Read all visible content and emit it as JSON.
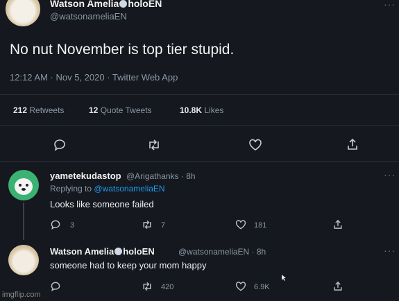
{
  "main_tweet": {
    "author_name_a": "Watson Amelia",
    "author_name_b": "holoEN",
    "handle": "@watsonameliaEN",
    "text": "No nut November is top tier stupid.",
    "timestamp": "12:12 AM · Nov 5, 2020 · Twitter Web App",
    "stats": [
      {
        "value": "212",
        "label": "Retweets"
      },
      {
        "value": "12",
        "label": "Quote Tweets"
      },
      {
        "value": "10.8K",
        "label": "Likes"
      }
    ]
  },
  "reply1": {
    "author_name": "yametekudastop",
    "handle_time": "@Arigathanks · 8h",
    "replying_prefix": "Replying to ",
    "replying_to": "@watsonameliaEN",
    "text": "Looks like someone failed",
    "replies": "3",
    "retweets": "7",
    "likes": "181"
  },
  "reply2": {
    "author_name_a": "Watson Amelia",
    "author_name_b": "holoEN",
    "handle_time": "@watsonameliaEN · 8h",
    "text": "someone had to keep your mom happy",
    "retweets": "420",
    "likes": "6.9K"
  },
  "more_glyph": "···",
  "watermark": "imgflip.com",
  "colors": {
    "background": "#15181e",
    "link": "#1d9bf0",
    "muted": "#8b98a5"
  }
}
